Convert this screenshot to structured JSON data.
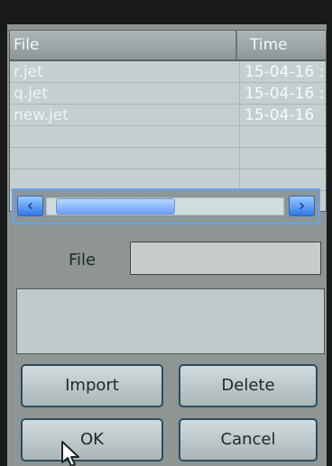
{
  "file_list": {
    "columns": [
      "File",
      "Time"
    ],
    "rows": [
      {
        "name": "r.jet",
        "time": "15-04-16 :"
      },
      {
        "name": "q.jet",
        "time": "15-04-16 :"
      },
      {
        "name": "new.jet",
        "time": "15-04-16"
      },
      {
        "name": "",
        "time": ""
      },
      {
        "name": "",
        "time": ""
      },
      {
        "name": "",
        "time": ""
      },
      {
        "name": "",
        "time": ""
      }
    ],
    "scrollbar": {
      "left_icon": "chevron-left-icon",
      "right_icon": "chevron-right-icon",
      "left_glyph": "‹",
      "right_glyph": "›"
    }
  },
  "form": {
    "file_label": "File",
    "file_value": ""
  },
  "message": "",
  "buttons": {
    "import": "Import",
    "delete": "Delete",
    "ok": "OK",
    "cancel": "Cancel"
  },
  "colors": {
    "panel": "#8f9593",
    "list_bg": "#c4cfd0",
    "scroll_accent": "#2e79e9"
  },
  "icons": {
    "pointer": "mouse-pointer-icon"
  }
}
